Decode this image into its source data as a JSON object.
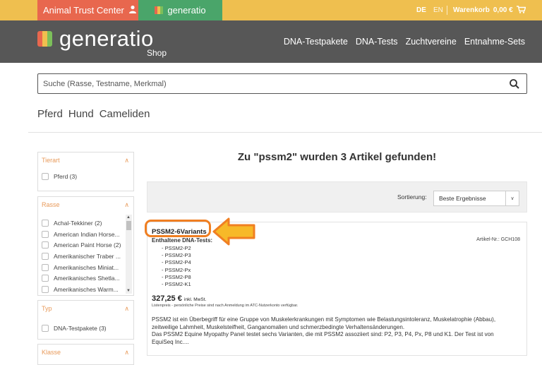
{
  "topbar": {
    "atc_label": "Animal Trust Center",
    "generatio_label": "generatio",
    "lang_de": "DE",
    "lang_en": "EN",
    "cart_label": "Warenkorb",
    "cart_total": "0,00 €"
  },
  "header": {
    "logo_text": "generatio",
    "logo_sub": "Shop",
    "nav": [
      "DNA-Testpakete",
      "DNA-Tests",
      "Zuchtvereine",
      "Entnahme-Sets"
    ]
  },
  "search": {
    "placeholder": "Suche (Rasse, Testname, Merkmal)"
  },
  "species": [
    "Pferd",
    "Hund",
    "Cameliden"
  ],
  "filters": {
    "tierart": {
      "title": "Tierart",
      "options": [
        "Pferd (3)"
      ]
    },
    "rasse": {
      "title": "Rasse",
      "options": [
        "Achal-Tekkiner (2)",
        "American Indian Horse...",
        "American Paint Horse (2)",
        "Amerikanischer Traber ...",
        "Amerikanisches Miniat...",
        "Amerikanisches Shetla...",
        "Amerikanisches Warm..."
      ]
    },
    "typ": {
      "title": "Typ",
      "options": [
        "DNA-Testpakete (3)"
      ]
    },
    "klasse": {
      "title": "Klasse"
    }
  },
  "results": {
    "title": "Zu \"pssm2\" wurden 3 Artikel gefunden!",
    "sort_label": "Sortierung:",
    "sort_value": "Beste Ergebnisse"
  },
  "product": {
    "name": "PSSM2-6Variants",
    "contained_label": "Enthaltene DNA-Tests:",
    "tests": [
      "- PSSM2-P2",
      "- PSSM2-P3",
      "- PSSM2-P4",
      "- PSSM2-Px",
      "- PSSM2-P8",
      "- PSSM2-K1"
    ],
    "artnr": "Artikel-Nr.: GCH108",
    "price": "327,25 €",
    "price_suffix": "inkl. MwSt.",
    "price_note": "Listenpreis - persönliche Preise sind nach Anmeldung im ATC-Nutzerkonto verfügbar.",
    "desc": [
      "PSSM2 ist ein Überbegriff für eine Gruppe von Muskelerkrankungen mit Symptomen wie Belastungsintoleranz, Muskelatrophie (Abbau),",
      "zeitweilige Lahmheit, Muskelsteifheit, Ganganomalien und schmerzbedingte Verhaltensänderungen.",
      "Das PSSM2 Equine Myopathy Panel testet sechs Varianten, die mit PSSM2 assoziiert sind: P2, P3, P4, Px, P8 und K1. Der Test ist von",
      "EquiSeq Inc...."
    ]
  },
  "colors": {
    "topbar": "#efbf4f",
    "atc": "#e8674e",
    "generatio_tab": "#4aa56a",
    "header": "#575757",
    "accent": "#e89a5a",
    "highlight": "#f07f22"
  },
  "icons": [
    "user-icon",
    "generatio-logo-icon",
    "cart-icon",
    "search-icon",
    "chevron-up-icon",
    "chevron-down-icon",
    "arrow-left-icon"
  ]
}
